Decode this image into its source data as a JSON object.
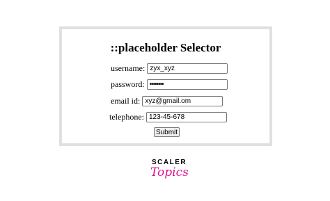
{
  "page": {
    "title": "::placeholder Selector"
  },
  "form": {
    "username": {
      "label": "username:",
      "value": "zyx_xyz"
    },
    "password": {
      "label": "password:",
      "value": "••••••••"
    },
    "email": {
      "label": "email id:",
      "value": "xyz@gmail.om"
    },
    "telephone": {
      "label": "telephone:",
      "value": "123-45-678"
    },
    "submit_label": "Submit"
  },
  "brand": {
    "name_top": "SCALER",
    "name_bottom": "Topics",
    "accent_color": "#e0138f"
  }
}
